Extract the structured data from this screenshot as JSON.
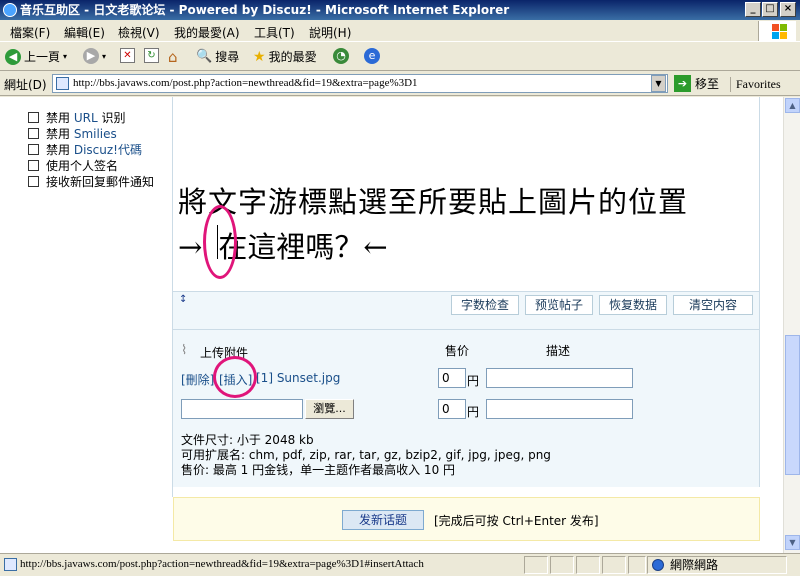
{
  "window": {
    "title": "音乐互助区 - 日文老歌论坛 - Powered by Discuz! - Microsoft Internet Explorer",
    "minimize": "_",
    "maximize": "□",
    "close": "×"
  },
  "menu": {
    "items": [
      "檔案(F)",
      "編輯(E)",
      "檢視(V)",
      "我的最愛(A)",
      "工具(T)",
      "說明(H)"
    ]
  },
  "toolbar": {
    "back": "上一頁",
    "search": "搜尋",
    "favorites": "我的最愛"
  },
  "address": {
    "label": "網址(D)",
    "url": "http://bbs.javaws.com/post.php?action=newthread&fid=19&extra=page%3D1",
    "go": "移至",
    "favorites_link": "Favorites"
  },
  "options": [
    {
      "prefix": "禁用",
      "highlight": " URL ",
      "suffix": "识别"
    },
    {
      "prefix": "禁用",
      "highlight": " Smilies",
      "suffix": ""
    },
    {
      "prefix": "禁用",
      "highlight": " Discuz!代碼",
      "suffix": ""
    },
    {
      "prefix": "使用个人签名",
      "highlight": "",
      "suffix": ""
    },
    {
      "prefix": "接收新回复郵件通知",
      "highlight": "",
      "suffix": ""
    }
  ],
  "editor": {
    "line1": "將文字游標點選至所要貼上圖片的位置",
    "line2_arrow": "→",
    "line2_text": "在這裡嗎？←"
  },
  "editor_tools": {
    "resize_icon": "↕",
    "buttons": [
      "字数检查",
      "预览帖子",
      "恢复数据",
      "清空内容"
    ]
  },
  "attach": {
    "title": "上传附件",
    "price_header": "售价",
    "desc_header": "描述",
    "row1": {
      "delete": "[刪除]",
      "insert": "[插入]",
      "file": "[1] Sunset.jpg",
      "price": "0",
      "unit": "円"
    },
    "row2": {
      "browse": "瀏覽...",
      "price": "0",
      "unit": "円"
    },
    "size_limit": "文件尺寸: 小于 2048 kb",
    "extensions": "可用扩展名: chm, pdf, zip, rar, tar, gz, bzip2, gif, jpg, jpeg, png",
    "price_note": "售价: 最高 1 円金钱，单一主题作者最高收入 10 円"
  },
  "submit": {
    "button": "发新话题",
    "hint": "[完成后可按 Ctrl+Enter 发布]"
  },
  "status": {
    "url": "http://bbs.javaws.com/post.php?action=newthread&fid=19&extra=page%3D1#insertAttach",
    "zone": "網際網路"
  },
  "colors": {
    "link": "#1a4f8a",
    "highlight_mark": "#e0157a",
    "submit_bg": "#fefce8"
  }
}
